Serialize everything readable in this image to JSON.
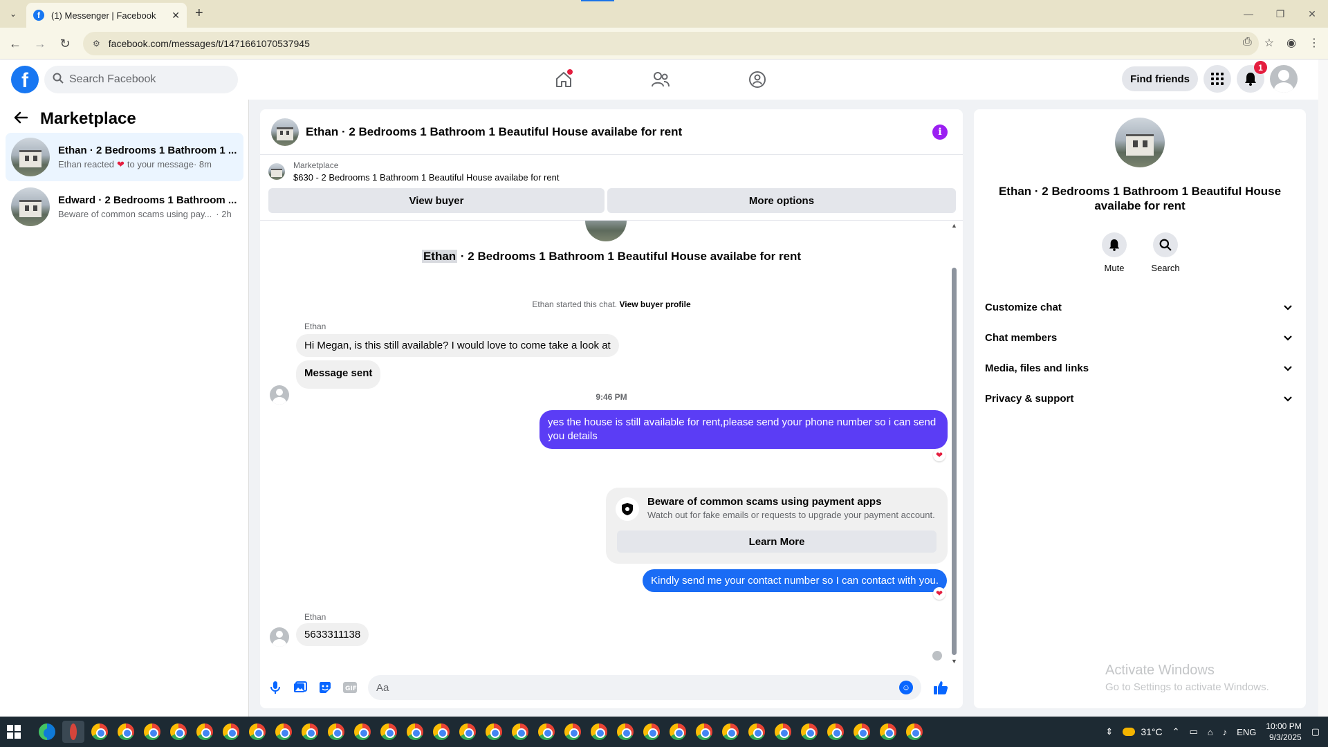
{
  "browser": {
    "tab_title": "(1) Messenger | Facebook",
    "url": "facebook.com/messages/t/1471661070537945"
  },
  "topnav": {
    "search_placeholder": "Search Facebook",
    "find_friends": "Find friends",
    "notification_count": "1"
  },
  "sidebar": {
    "title": "Marketplace",
    "conversations": [
      {
        "title": "Ethan · 2 Bedrooms 1 Bathroom 1 ...",
        "preview_before": "Ethan reacted",
        "preview_after": "to your message",
        "time": "· 8m"
      },
      {
        "title": "Edward · 2 Bedrooms 1 Bathroom ...",
        "preview_before": "Beware of common scams using pay...",
        "time": "· 2h"
      }
    ]
  },
  "chat": {
    "header_title": "Ethan · 2 Bedrooms 1 Bathroom 1 Beautiful House availabe for rent",
    "listing_label": "Marketplace",
    "listing_desc": "$630 - 2 Bedrooms 1 Bathroom 1 Beautiful House availabe for rent",
    "view_buyer": "View buyer",
    "more_options": "More options",
    "intro_name": "Ethan",
    "intro_rest": " · 2 Bedrooms 1 Bathroom 1 Beautiful House availabe for rent",
    "started_text": "Ethan started this chat.",
    "view_buyer_profile": "View buyer profile",
    "messages": [
      {
        "sender": "Ethan",
        "text": "Hi Megan, is this still available? I would love to come take a look at"
      },
      {
        "text": "Message sent"
      },
      {
        "timestamp": "9:46 PM"
      },
      {
        "text": "yes the house is still available for rent,please send your  phone number so i can send you details"
      },
      {
        "text": "Kindly send me your contact number so I can contact with you."
      },
      {
        "sender": "Ethan",
        "text": "5633311138"
      }
    ],
    "scam_card": {
      "title": "Beware of common scams using payment apps",
      "subtitle": "Watch out for fake emails or requests to upgrade your payment account.",
      "button": "Learn More"
    },
    "composer_placeholder": "Aa"
  },
  "info_panel": {
    "title": "Ethan · 2 Bedrooms 1 Bathroom 1 Beautiful House availabe for rent",
    "mute": "Mute",
    "search": "Search",
    "sections": [
      "Customize chat",
      "Chat members",
      "Media, files and links",
      "Privacy & support"
    ],
    "activate_title": "Activate Windows",
    "activate_sub": "Go to Settings to activate Windows."
  },
  "taskbar": {
    "temperature": "31°C",
    "language": "ENG",
    "time": "10:00 PM",
    "date": "9/3/2025"
  }
}
